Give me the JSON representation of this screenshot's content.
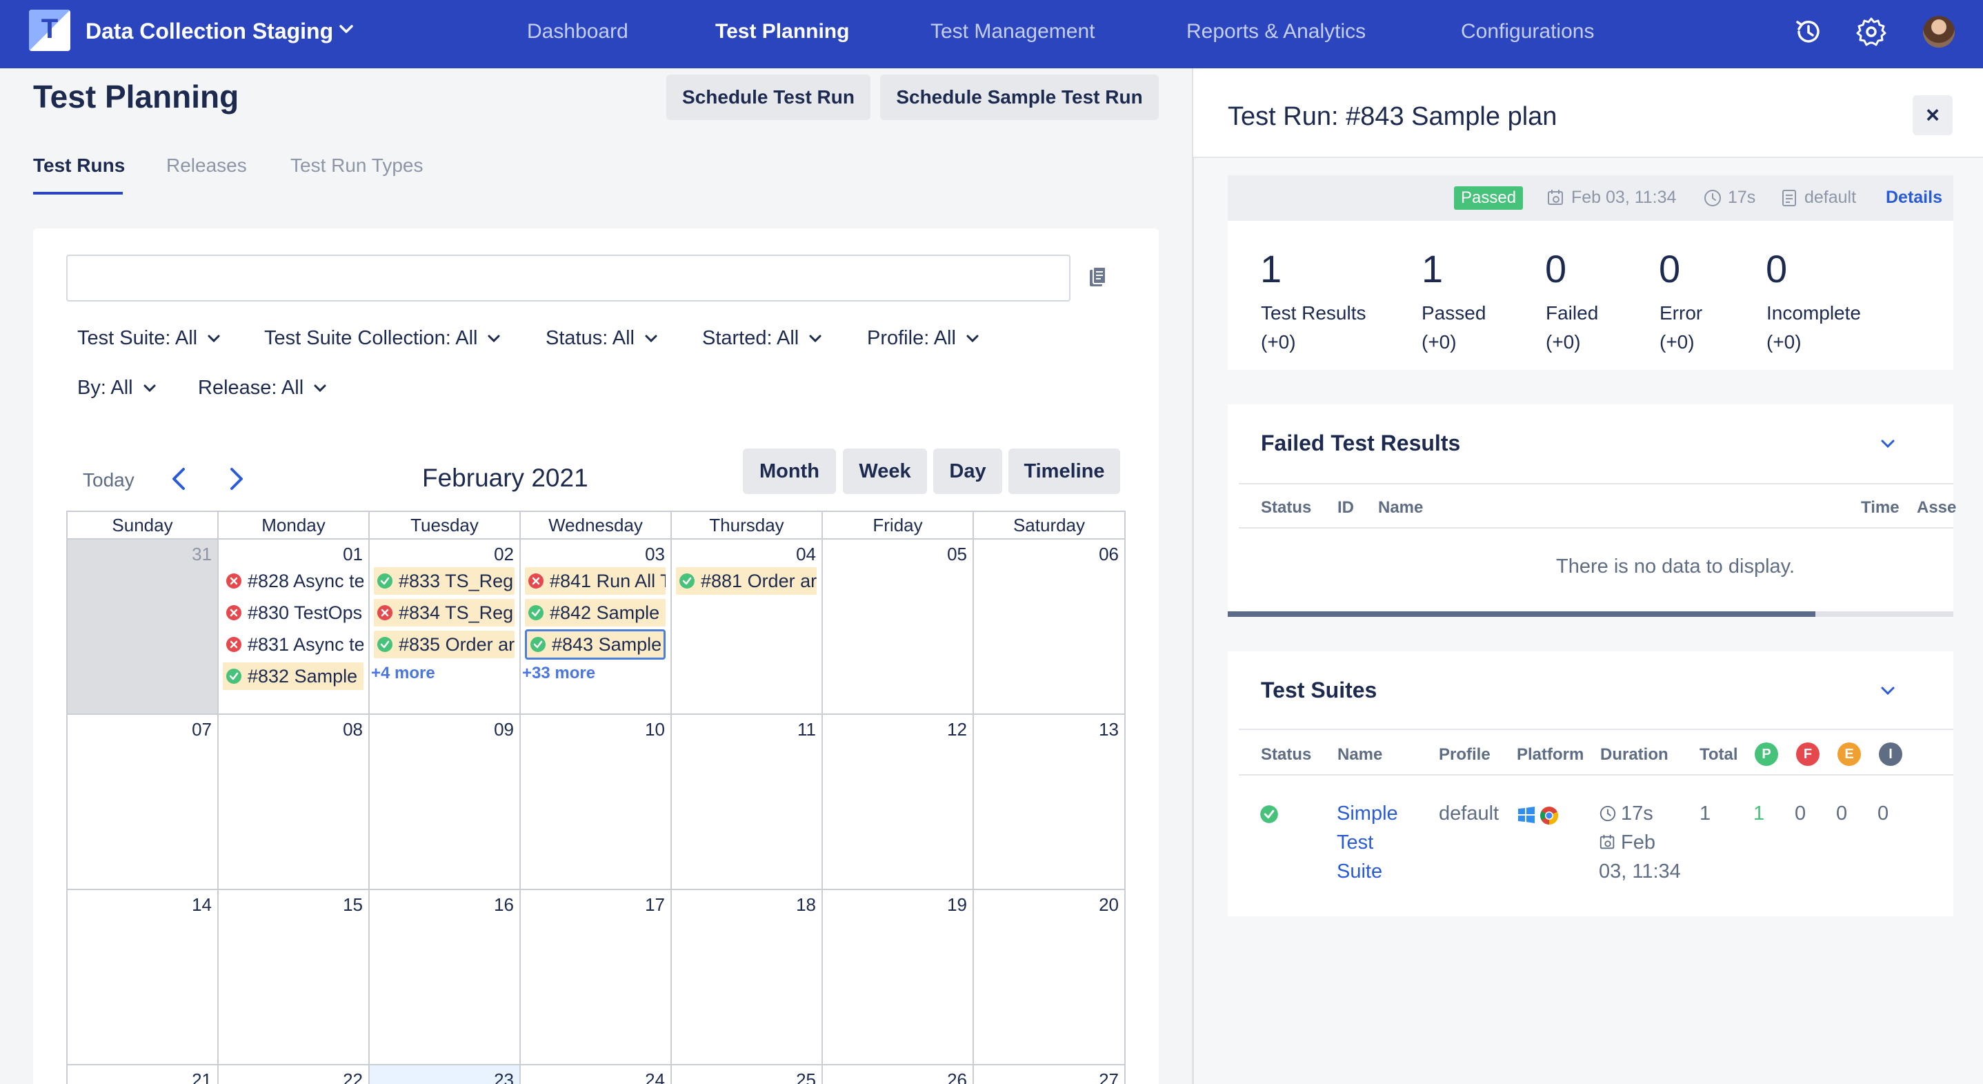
{
  "nav": {
    "project": "Data Collection Staging",
    "items": [
      "Dashboard",
      "Test Planning",
      "Test Management",
      "Reports & Analytics",
      "Configurations"
    ],
    "logo_letter": "T"
  },
  "page": {
    "title": "Test Planning",
    "buttons": {
      "schedule": "Schedule Test Run",
      "schedule_sample": "Schedule Sample Test Run"
    },
    "tabs": [
      "Test Runs",
      "Releases",
      "Test Run Types"
    ]
  },
  "filters": {
    "search_value": "",
    "items": [
      "Test Suite: All",
      "Test Suite Collection: All",
      "Status: All",
      "Started: All",
      "Profile: All",
      "By: All",
      "Release: All"
    ]
  },
  "calendar": {
    "today_label": "Today",
    "month_label": "February 2021",
    "views": [
      "Month",
      "Week",
      "Day",
      "Timeline"
    ],
    "weekdays": [
      "Sunday",
      "Monday",
      "Tuesday",
      "Wednesday",
      "Thursday",
      "Friday",
      "Saturday"
    ],
    "weeks": [
      [
        "31",
        "01",
        "02",
        "03",
        "04",
        "05",
        "06"
      ],
      [
        "07",
        "08",
        "09",
        "10",
        "11",
        "12",
        "13"
      ],
      [
        "14",
        "15",
        "16",
        "17",
        "18",
        "19",
        "20"
      ],
      [
        "21",
        "22",
        "23",
        "24",
        "25",
        "26",
        "27"
      ]
    ],
    "events": {
      "mon01": [
        "#828 Async te",
        "#830 TestOps",
        "#831 Async te",
        "#832 Sample"
      ],
      "tue02": [
        "#833 TS_Reg",
        "#834 TS_Reg",
        "#835 Order ar"
      ],
      "wed03": [
        "#841 Run All T",
        "#842 Sample",
        "#843 Sample"
      ],
      "thu04": [
        "#881 Order ar"
      ]
    },
    "more": {
      "tue02": "+4 more",
      "wed03": "+33 more"
    }
  },
  "panel": {
    "title": "Test Run: #843 Sample plan",
    "close": "×",
    "status_badge": "Passed",
    "date": "Feb 03, 11:34",
    "duration": "17s",
    "profile": "default",
    "details_link": "Details",
    "stats": [
      {
        "num": "1",
        "label": "Test Results",
        "delta": "(+0)"
      },
      {
        "num": "1",
        "label": "Passed",
        "delta": "(+0)"
      },
      {
        "num": "0",
        "label": "Failed",
        "delta": "(+0)"
      },
      {
        "num": "0",
        "label": "Error",
        "delta": "(+0)"
      },
      {
        "num": "0",
        "label": "Incomplete",
        "delta": "(+0)"
      }
    ],
    "failed": {
      "title": "Failed Test Results",
      "headers": [
        "Status",
        "ID",
        "Name",
        "Time",
        "Asse"
      ],
      "empty": "There is no data to display.",
      "scroll_progress": 0.81
    },
    "suites": {
      "title": "Test Suites",
      "headers": [
        "Status",
        "Name",
        "Profile",
        "Platform",
        "Duration",
        "Total"
      ],
      "count_icons": [
        "P",
        "F",
        "E",
        "I"
      ],
      "row": {
        "name_lines": [
          "Simple",
          "Test",
          "Suite"
        ],
        "profile": "default",
        "duration": "17s",
        "date_line1": "Feb",
        "date_line2": "03, 11:34",
        "total": "1",
        "p": "1",
        "f": "0",
        "e": "0",
        "i": "0"
      }
    }
  },
  "colors": {
    "nav_bg": "#2a45bd",
    "passed": "#47c27a",
    "failed": "#e5484d",
    "event_bg": "#fcebc7",
    "link": "#2a5bd7",
    "error_icon": "#f0a030",
    "incomplete_icon": "#5e6c84"
  }
}
